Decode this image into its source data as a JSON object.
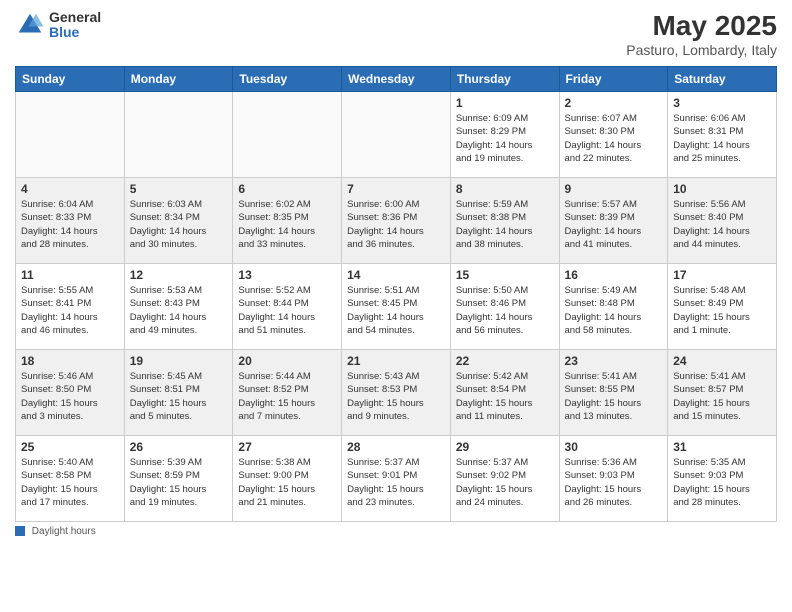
{
  "logo": {
    "general": "General",
    "blue": "Blue"
  },
  "title": "May 2025",
  "subtitle": "Pasturo, Lombardy, Italy",
  "headers": [
    "Sunday",
    "Monday",
    "Tuesday",
    "Wednesday",
    "Thursday",
    "Friday",
    "Saturday"
  ],
  "weeks": [
    [
      {
        "day": "",
        "content": ""
      },
      {
        "day": "",
        "content": ""
      },
      {
        "day": "",
        "content": ""
      },
      {
        "day": "",
        "content": ""
      },
      {
        "day": "1",
        "content": "Sunrise: 6:09 AM\nSunset: 8:29 PM\nDaylight: 14 hours\nand 19 minutes."
      },
      {
        "day": "2",
        "content": "Sunrise: 6:07 AM\nSunset: 8:30 PM\nDaylight: 14 hours\nand 22 minutes."
      },
      {
        "day": "3",
        "content": "Sunrise: 6:06 AM\nSunset: 8:31 PM\nDaylight: 14 hours\nand 25 minutes."
      }
    ],
    [
      {
        "day": "4",
        "content": "Sunrise: 6:04 AM\nSunset: 8:33 PM\nDaylight: 14 hours\nand 28 minutes."
      },
      {
        "day": "5",
        "content": "Sunrise: 6:03 AM\nSunset: 8:34 PM\nDaylight: 14 hours\nand 30 minutes."
      },
      {
        "day": "6",
        "content": "Sunrise: 6:02 AM\nSunset: 8:35 PM\nDaylight: 14 hours\nand 33 minutes."
      },
      {
        "day": "7",
        "content": "Sunrise: 6:00 AM\nSunset: 8:36 PM\nDaylight: 14 hours\nand 36 minutes."
      },
      {
        "day": "8",
        "content": "Sunrise: 5:59 AM\nSunset: 8:38 PM\nDaylight: 14 hours\nand 38 minutes."
      },
      {
        "day": "9",
        "content": "Sunrise: 5:57 AM\nSunset: 8:39 PM\nDaylight: 14 hours\nand 41 minutes."
      },
      {
        "day": "10",
        "content": "Sunrise: 5:56 AM\nSunset: 8:40 PM\nDaylight: 14 hours\nand 44 minutes."
      }
    ],
    [
      {
        "day": "11",
        "content": "Sunrise: 5:55 AM\nSunset: 8:41 PM\nDaylight: 14 hours\nand 46 minutes."
      },
      {
        "day": "12",
        "content": "Sunrise: 5:53 AM\nSunset: 8:43 PM\nDaylight: 14 hours\nand 49 minutes."
      },
      {
        "day": "13",
        "content": "Sunrise: 5:52 AM\nSunset: 8:44 PM\nDaylight: 14 hours\nand 51 minutes."
      },
      {
        "day": "14",
        "content": "Sunrise: 5:51 AM\nSunset: 8:45 PM\nDaylight: 14 hours\nand 54 minutes."
      },
      {
        "day": "15",
        "content": "Sunrise: 5:50 AM\nSunset: 8:46 PM\nDaylight: 14 hours\nand 56 minutes."
      },
      {
        "day": "16",
        "content": "Sunrise: 5:49 AM\nSunset: 8:48 PM\nDaylight: 14 hours\nand 58 minutes."
      },
      {
        "day": "17",
        "content": "Sunrise: 5:48 AM\nSunset: 8:49 PM\nDaylight: 15 hours\nand 1 minute."
      }
    ],
    [
      {
        "day": "18",
        "content": "Sunrise: 5:46 AM\nSunset: 8:50 PM\nDaylight: 15 hours\nand 3 minutes."
      },
      {
        "day": "19",
        "content": "Sunrise: 5:45 AM\nSunset: 8:51 PM\nDaylight: 15 hours\nand 5 minutes."
      },
      {
        "day": "20",
        "content": "Sunrise: 5:44 AM\nSunset: 8:52 PM\nDaylight: 15 hours\nand 7 minutes."
      },
      {
        "day": "21",
        "content": "Sunrise: 5:43 AM\nSunset: 8:53 PM\nDaylight: 15 hours\nand 9 minutes."
      },
      {
        "day": "22",
        "content": "Sunrise: 5:42 AM\nSunset: 8:54 PM\nDaylight: 15 hours\nand 11 minutes."
      },
      {
        "day": "23",
        "content": "Sunrise: 5:41 AM\nSunset: 8:55 PM\nDaylight: 15 hours\nand 13 minutes."
      },
      {
        "day": "24",
        "content": "Sunrise: 5:41 AM\nSunset: 8:57 PM\nDaylight: 15 hours\nand 15 minutes."
      }
    ],
    [
      {
        "day": "25",
        "content": "Sunrise: 5:40 AM\nSunset: 8:58 PM\nDaylight: 15 hours\nand 17 minutes."
      },
      {
        "day": "26",
        "content": "Sunrise: 5:39 AM\nSunset: 8:59 PM\nDaylight: 15 hours\nand 19 minutes."
      },
      {
        "day": "27",
        "content": "Sunrise: 5:38 AM\nSunset: 9:00 PM\nDaylight: 15 hours\nand 21 minutes."
      },
      {
        "day": "28",
        "content": "Sunrise: 5:37 AM\nSunset: 9:01 PM\nDaylight: 15 hours\nand 23 minutes."
      },
      {
        "day": "29",
        "content": "Sunrise: 5:37 AM\nSunset: 9:02 PM\nDaylight: 15 hours\nand 24 minutes."
      },
      {
        "day": "30",
        "content": "Sunrise: 5:36 AM\nSunset: 9:03 PM\nDaylight: 15 hours\nand 26 minutes."
      },
      {
        "day": "31",
        "content": "Sunrise: 5:35 AM\nSunset: 9:03 PM\nDaylight: 15 hours\nand 28 minutes."
      }
    ]
  ],
  "footer": {
    "label": "Daylight hours"
  }
}
